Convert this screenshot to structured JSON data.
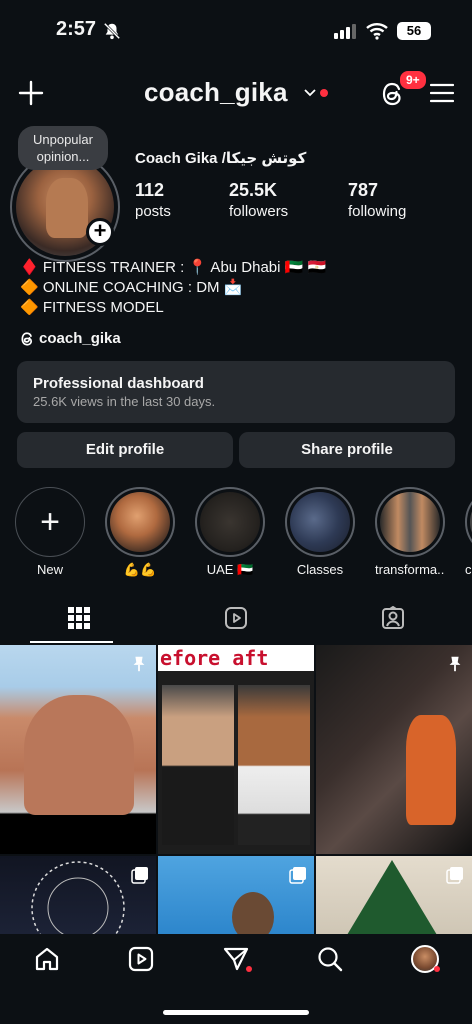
{
  "status": {
    "time": "2:57",
    "battery": "56"
  },
  "header": {
    "username": "coach_gika",
    "notif_badge": "9+"
  },
  "profile": {
    "note": "Unpopular opinion...",
    "display_name": "Coach Gika /كوتش جيكا",
    "stats": [
      {
        "num": "112",
        "label": "posts"
      },
      {
        "num": "25.5K",
        "label": "followers"
      },
      {
        "num": "787",
        "label": "following"
      }
    ],
    "bio": [
      "♦️ FITNESS TRAINER : 📍 Abu Dhabi 🇦🇪 🇪🇬",
      "🔶 ONLINE COACHING : DM 📩",
      "🔶 FITNESS MODEL"
    ],
    "threads_handle": "coach_gika"
  },
  "dashboard": {
    "title": "Professional dashboard",
    "subtitle": "25.6K views in the last 30 days."
  },
  "buttons": {
    "edit": "Edit profile",
    "share": "Share profile"
  },
  "highlights": [
    {
      "label": "New"
    },
    {
      "label": "💪💪"
    },
    {
      "label": "UAE 🇦🇪"
    },
    {
      "label": "Classes"
    },
    {
      "label": "transforma..."
    },
    {
      "label": "c"
    }
  ],
  "grid": {
    "post2_banner": "efore aft"
  },
  "icons": {
    "tabs": [
      "grid-icon",
      "reels-icon",
      "tagged-icon"
    ],
    "nav": [
      "home-icon",
      "reels-icon",
      "messages-icon",
      "search-icon",
      "profile-avatar"
    ]
  },
  "colors": {
    "background": "#0c1014",
    "accent_red": "#ff3040",
    "surface": "#262a2f"
  }
}
